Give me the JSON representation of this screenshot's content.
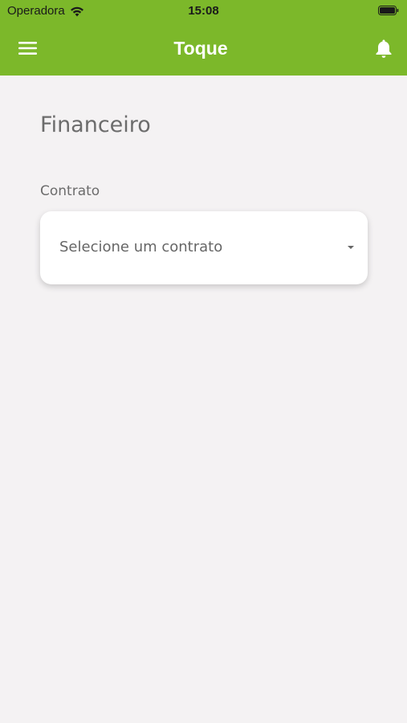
{
  "status_bar": {
    "carrier": "Operadora",
    "time": "15:08"
  },
  "app_bar": {
    "title": "Toque",
    "background_color": "#7cb82a",
    "menu_icon": "hamburger-menu-icon",
    "notification_icon": "bell-icon"
  },
  "page": {
    "title": "Financeiro",
    "contract_field": {
      "label": "Contrato",
      "value": "Selecione um contrato",
      "dropdown_icon": "caret-down-icon"
    }
  }
}
